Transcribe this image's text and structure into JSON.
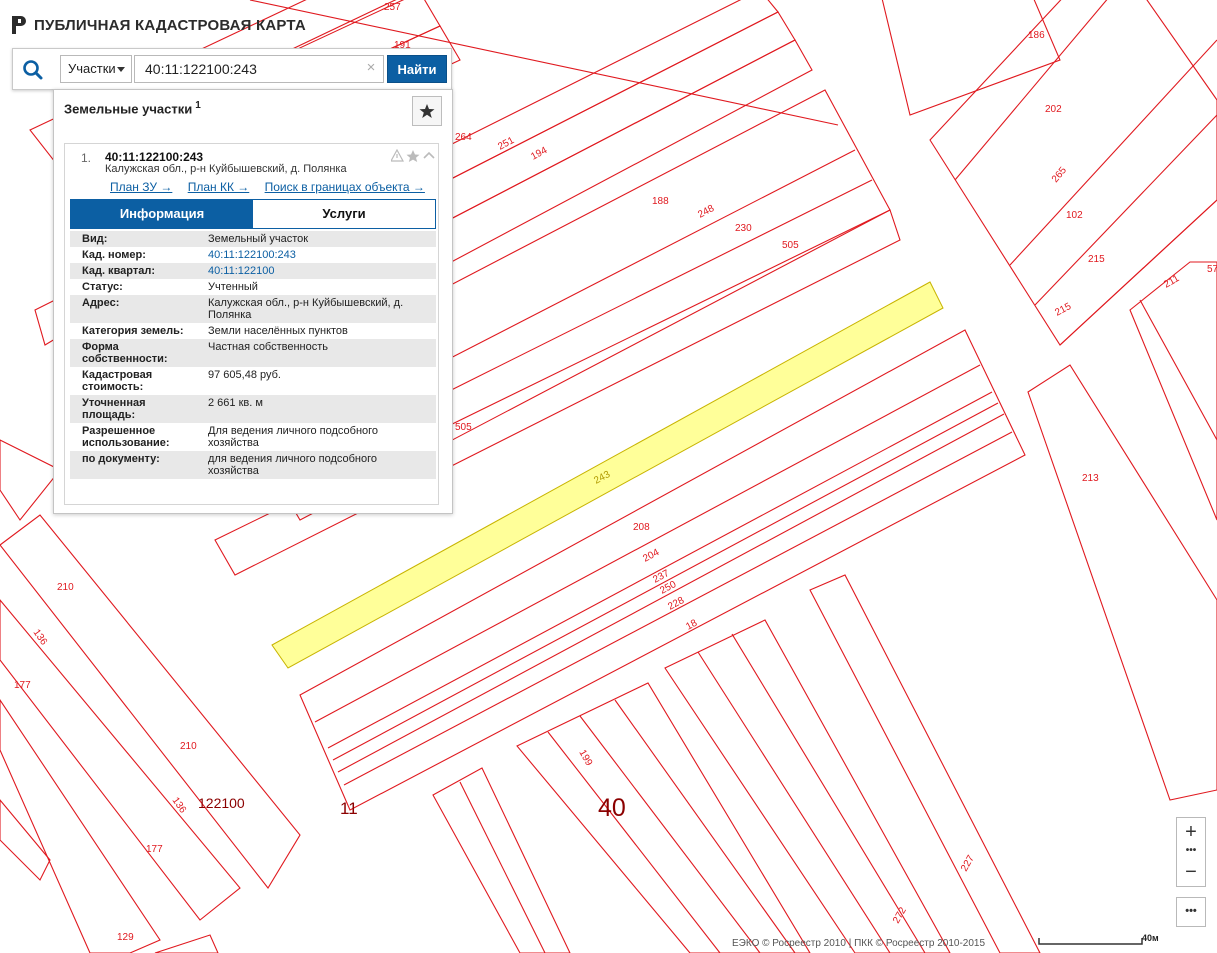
{
  "app": {
    "title": "ПУБЛИЧНАЯ КАДАСТРОВАЯ КАРТА"
  },
  "search": {
    "type_selected": "Участки",
    "query": "40:11:122100:243",
    "clear_label": "×",
    "find_label": "Найти"
  },
  "panel": {
    "title": "Земельные участки",
    "count": "1"
  },
  "result": {
    "index": "1.",
    "cadastral_number": "40:11:122100:243",
    "address_short": "Калужская обл., р-н Куйбышевский, д. Полянка",
    "links": [
      "План ЗУ →",
      "План КК →",
      "Поиск в границах объекта →"
    ],
    "tabs": [
      "Информация",
      "Услуги"
    ],
    "active_tab": "Информация",
    "fields": [
      {
        "key": "Вид:",
        "value": "Земельный участок"
      },
      {
        "key": "Кад. номер:",
        "value": "40:11:122100:243",
        "link": true
      },
      {
        "key": "Кад. квартал:",
        "value": "40:11:122100",
        "link": true
      },
      {
        "key": "Статус:",
        "value": "Учтенный"
      },
      {
        "key": "Адрес:",
        "value": "Калужская обл., р-н Куйбышевский, д. Полянка"
      },
      {
        "key": "Категория земель:",
        "value": "Земли населённых пунктов"
      },
      {
        "key": "Форма собственности:",
        "value": "Частная собственность"
      },
      {
        "key": "Кадастровая стоимость:",
        "value": "97 605,48 руб."
      },
      {
        "key": "Уточненная площадь:",
        "value": "2 661 кв. м"
      },
      {
        "key": "Разрешенное использование:",
        "value": "Для ведения личного подсобного хозяйства"
      },
      {
        "key": "по документу:",
        "value": "для ведения личного подсобного хозяйства"
      }
    ]
  },
  "map": {
    "parcel_color": "#e0191f",
    "highlight_fill": "#ffff99",
    "highlight_stroke": "#c8b400",
    "block_label_color": "#8b0000",
    "labels": {
      "p257": "257",
      "p191": "191",
      "p186": "186",
      "p264": "264",
      "p251": "251",
      "p194": "194",
      "p202": "202",
      "p188": "188",
      "p248": "248",
      "p230": "230",
      "p505a": "505",
      "p265": "265",
      "p102": "102",
      "p215a": "215",
      "p215b": "215",
      "p211": "211",
      "p57": "57",
      "p505b": "505",
      "p243": "243",
      "p208": "208",
      "p204": "204",
      "p237": "237",
      "p250": "250",
      "p228": "228",
      "p18": "18",
      "p213": "213",
      "p210a": "210",
      "p136a": "136",
      "p177a": "177",
      "p210b": "210",
      "p136b": "136",
      "p177b": "177",
      "p129": "129",
      "p199": "199",
      "p227": "227",
      "p272": "272"
    },
    "quarter_label": "122100",
    "block_11": "11",
    "block_40": "40"
  },
  "controls": {
    "zoom_in": "+",
    "zoom_out": "−",
    "zoom_dots": "•••",
    "more": "•••"
  },
  "attribution": "ЕЭКО © Росреестр 2010 | ПКК © Росреестр 2010-2015",
  "scale_label": "40м"
}
